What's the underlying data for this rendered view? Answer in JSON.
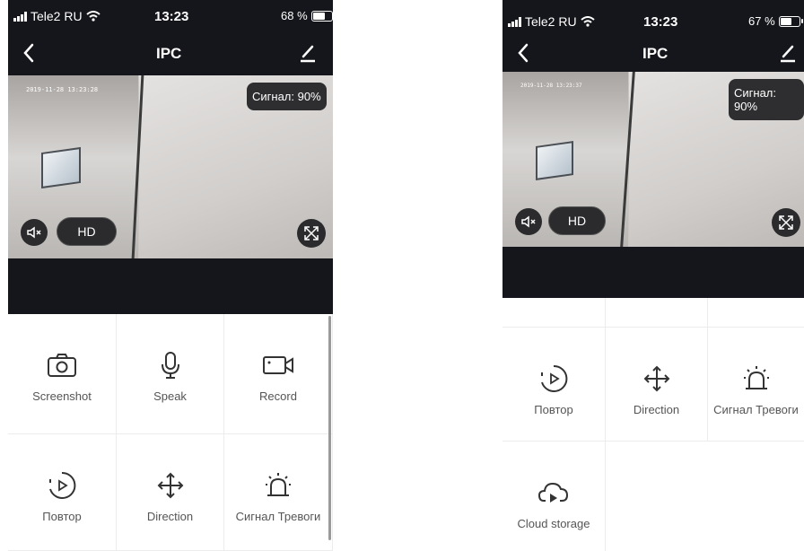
{
  "status": {
    "carrier": "Tele2 RU",
    "time": "13:23"
  },
  "left": {
    "battery": "68 %",
    "battery_level": 0.68,
    "title": "IPC",
    "timestamp": "2019-11-28 13:23:28",
    "signal": "Сигнал: 90%",
    "quality": "HD",
    "functions": [
      {
        "label": "Screenshot",
        "icon": "camera-icon"
      },
      {
        "label": "Speak",
        "icon": "microphone-icon"
      },
      {
        "label": "Record",
        "icon": "video-camera-icon"
      },
      {
        "label": "Повтор",
        "icon": "playback-icon"
      },
      {
        "label": "Direction",
        "icon": "move-arrows-icon"
      },
      {
        "label": "Сигнал Тревоги",
        "icon": "alarm-siren-icon"
      }
    ]
  },
  "right": {
    "battery": "67 %",
    "battery_level": 0.67,
    "title": "IPC",
    "timestamp": "2019-11-28 13:23:37",
    "signal": "Сигнал: 90%",
    "quality": "HD",
    "functions": [
      {
        "label": "Повтор",
        "icon": "playback-icon"
      },
      {
        "label": "Direction",
        "icon": "move-arrows-icon"
      },
      {
        "label": "Сигнал Тревоги",
        "icon": "alarm-siren-icon"
      },
      {
        "label": "Cloud storage",
        "icon": "cloud-storage-icon"
      }
    ]
  }
}
